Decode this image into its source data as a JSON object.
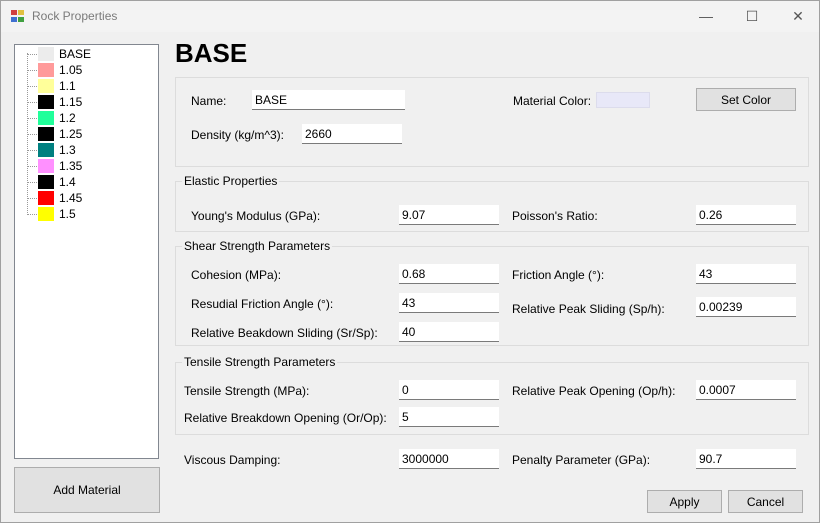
{
  "window": {
    "title": "Rock Properties",
    "controls": {
      "minimize": "—",
      "maximize": "☐",
      "close": "✕"
    }
  },
  "materials": [
    {
      "label": "BASE",
      "color": "#ececec"
    },
    {
      "label": "1.05",
      "color": "#ff9a9a"
    },
    {
      "label": "1.1",
      "color": "#ffff9a"
    },
    {
      "label": "1.15",
      "color": "#000000"
    },
    {
      "label": "1.2",
      "color": "#20ff9a"
    },
    {
      "label": "1.25",
      "color": "#000000"
    },
    {
      "label": "1.3",
      "color": "#008080"
    },
    {
      "label": "1.35",
      "color": "#ff90ff"
    },
    {
      "label": "1.4",
      "color": "#000000"
    },
    {
      "label": "1.45",
      "color": "#ff0000"
    },
    {
      "label": "1.5",
      "color": "#ffff00"
    }
  ],
  "add_material_label": "Add Material",
  "heading": "BASE",
  "general": {
    "name_label": "Name:",
    "name_value": "BASE",
    "material_color_label": "Material Color:",
    "material_color": "#e8e8f8",
    "set_color_label": "Set Color",
    "density_label": "Density (kg/m^3):",
    "density_value": "2660"
  },
  "elastic": {
    "title": "Elastic Properties",
    "youngs_label": "Young's Modulus (GPa):",
    "youngs_value": "9.07",
    "poisson_label": "Poisson's Ratio:",
    "poisson_value": "0.26"
  },
  "shear": {
    "title": "Shear Strength Parameters",
    "cohesion_label": "Cohesion (MPa):",
    "cohesion_value": "0.68",
    "friction_label": "Friction Angle (°):",
    "friction_value": "43",
    "residual_label": "Resudial Friction Angle (°):",
    "residual_value": "43",
    "peak_sliding_label": "Relative Peak Sliding (Sp/h):",
    "peak_sliding_value": "0.00239",
    "breakdown_sliding_label": "Relative Beakdown Sliding (Sr/Sp):",
    "breakdown_sliding_value": "40"
  },
  "tensile": {
    "title": "Tensile Strength Parameters",
    "strength_label": "Tensile Strength (MPa):",
    "strength_value": "0",
    "peak_opening_label": "Relative Peak Opening (Op/h):",
    "peak_opening_value": "0.0007",
    "breakdown_opening_label": "Relative Breakdown Opening (Or/Op):",
    "breakdown_opening_value": "5"
  },
  "other": {
    "viscous_label": "Viscous Damping:",
    "viscous_value": "3000000",
    "penalty_label": "Penalty Parameter (GPa):",
    "penalty_value": "90.7"
  },
  "buttons": {
    "apply": "Apply",
    "cancel": "Cancel"
  }
}
